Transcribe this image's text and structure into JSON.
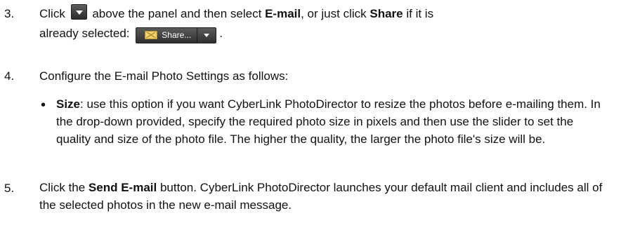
{
  "step3": {
    "number": "3.",
    "part1": "Click",
    "part2": "above the panel and then select",
    "emailLabel": "E-mail",
    "part3": ", or just click",
    "shareLabel": "Share",
    "part4": "if it is",
    "part5": "already selected:",
    "shareButtonText": "Share...",
    "end": "."
  },
  "step4": {
    "number": "4.",
    "text": "Configure the E-mail Photo Settings as follows:"
  },
  "sizeBullet": {
    "marker": "•",
    "label": "Size",
    "text": ": use this option if you want CyberLink PhotoDirector to resize the photos before e-mailing them. In the drop-down provided, specify the required photo size in pixels and then use the slider to set the quality and size of the photo file. The higher the quality, the larger the photo file's size will be."
  },
  "step5": {
    "number": "5.",
    "part1": "Click the",
    "buttonLabel": "Send E-mail",
    "part2": "button. CyberLink PhotoDirector launches your default mail client and includes all of the selected photos in the new e-mail message."
  },
  "icons": {
    "dropdown": "dropdown-arrow-icon",
    "mail": "envelope-icon",
    "shareDropdown": "chevron-down-icon"
  },
  "colors": {
    "text": "#111111",
    "buttonDark": "#303030",
    "envelope": "#f2d06b"
  }
}
